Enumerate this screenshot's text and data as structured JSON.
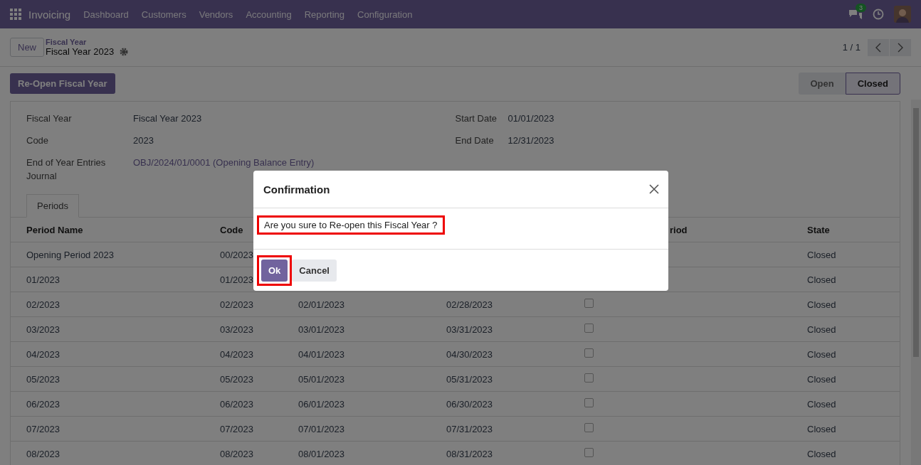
{
  "navbar": {
    "app_name": "Invoicing",
    "menu": [
      "Dashboard",
      "Customers",
      "Vendors",
      "Accounting",
      "Reporting",
      "Configuration"
    ],
    "chat_badge": "3"
  },
  "control_panel": {
    "new_button": "New",
    "breadcrumb_parent": "Fiscal Year",
    "breadcrumb_current": "Fiscal Year 2023",
    "pager": "1 / 1"
  },
  "action_button": "Re-Open Fiscal Year",
  "stages": [
    {
      "label": "Open",
      "selected": false
    },
    {
      "label": "Closed",
      "selected": true
    }
  ],
  "fields_left": [
    {
      "label": "Fiscal Year",
      "value": "Fiscal Year 2023",
      "kind": "text"
    },
    {
      "label": "Code",
      "value": "2023",
      "kind": "text"
    },
    {
      "label": "End of Year Entries Journal",
      "value": "OBJ/2024/01/0001 (Opening Balance Entry)",
      "kind": "link"
    }
  ],
  "fields_right": [
    {
      "label": "Start Date",
      "value": "01/01/2023"
    },
    {
      "label": "End Date",
      "value": "12/31/2023"
    }
  ],
  "tabs": [
    {
      "label": "Periods",
      "selected": true
    }
  ],
  "table": {
    "columns": [
      "Period Name",
      "Code",
      "riod",
      "State"
    ],
    "rows": [
      {
        "name": "Opening Period 2023",
        "code": "00/2023",
        "state": "Closed"
      },
      {
        "name": "01/2023",
        "code": "01/2023",
        "state": "Closed"
      },
      {
        "name": "02/2023",
        "code": "02/2023",
        "start": "02/01/2023",
        "end": "02/28/2023",
        "checked": false,
        "state": "Closed"
      },
      {
        "name": "03/2023",
        "code": "03/2023",
        "start": "03/01/2023",
        "end": "03/31/2023",
        "checked": false,
        "state": "Closed"
      },
      {
        "name": "04/2023",
        "code": "04/2023",
        "start": "04/01/2023",
        "end": "04/30/2023",
        "checked": false,
        "state": "Closed"
      },
      {
        "name": "05/2023",
        "code": "05/2023",
        "start": "05/01/2023",
        "end": "05/31/2023",
        "checked": false,
        "state": "Closed"
      },
      {
        "name": "06/2023",
        "code": "06/2023",
        "start": "06/01/2023",
        "end": "06/30/2023",
        "checked": false,
        "state": "Closed"
      },
      {
        "name": "07/2023",
        "code": "07/2023",
        "start": "07/01/2023",
        "end": "07/31/2023",
        "checked": false,
        "state": "Closed"
      },
      {
        "name": "08/2023",
        "code": "08/2023",
        "start": "08/01/2023",
        "end": "08/31/2023",
        "checked": false,
        "state": "Closed"
      }
    ]
  },
  "dialog": {
    "title": "Confirmation",
    "message": "Are you sure to Re-open this Fiscal Year ?",
    "buttons": [
      "Ok",
      "Cancel"
    ]
  }
}
